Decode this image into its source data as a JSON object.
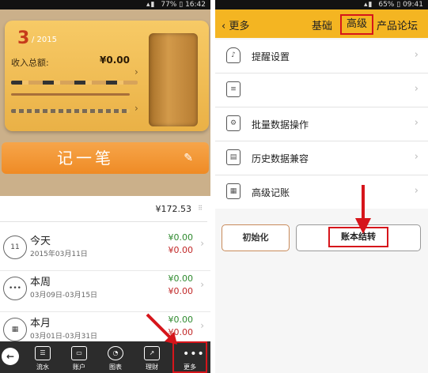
{
  "left": {
    "status": {
      "battery": "77%",
      "time": "16:42"
    },
    "card": {
      "month": "3",
      "year": "/ 2015",
      "income_label": "收入总额:",
      "income_value": "¥0.00"
    },
    "record_button": "记一笔",
    "balance": "¥172.53",
    "rows": [
      {
        "title": "今天",
        "date": "2015年03月11日",
        "icon_text": "11",
        "income": "¥0.00",
        "expense": "¥0.00"
      },
      {
        "title": "本周",
        "date": "03月09日-03月15日",
        "icon_text": "•••",
        "income": "¥0.00",
        "expense": "¥0.00"
      },
      {
        "title": "本月",
        "date": "03月01日-03月31日",
        "icon_text": "▦",
        "income": "¥0.00",
        "expense": "¥0.00"
      }
    ],
    "tabs": [
      {
        "label": "流水",
        "icon": "list-icon"
      },
      {
        "label": "账户",
        "icon": "card-icon"
      },
      {
        "label": "图表",
        "icon": "pie-chart-icon"
      },
      {
        "label": "理财",
        "icon": "trend-chart-icon"
      },
      {
        "label": "更多",
        "icon": "more-icon"
      }
    ]
  },
  "right": {
    "status": {
      "battery": "65%",
      "time": "09:41"
    },
    "header": {
      "back_label": "更多",
      "tab1": "基础",
      "tab2": "高级",
      "tab3": "产品论坛"
    },
    "menu": [
      {
        "label": "提醒设置",
        "icon": "bell-icon"
      },
      {
        "label": "",
        "icon": "document-icon"
      },
      {
        "label": "批量数据操作",
        "icon": "batch-settings-icon"
      },
      {
        "label": "历史数据兼容",
        "icon": "history-data-icon"
      },
      {
        "label": "高级记账",
        "icon": "advanced-record-icon"
      }
    ],
    "buttons": {
      "init": "初始化",
      "carry_over": "账本结转"
    }
  },
  "colors": {
    "header_yellow": "#f4b522",
    "highlight_red": "#d6151b",
    "income_green": "#2f8a2f",
    "expense_red": "#c12727"
  }
}
